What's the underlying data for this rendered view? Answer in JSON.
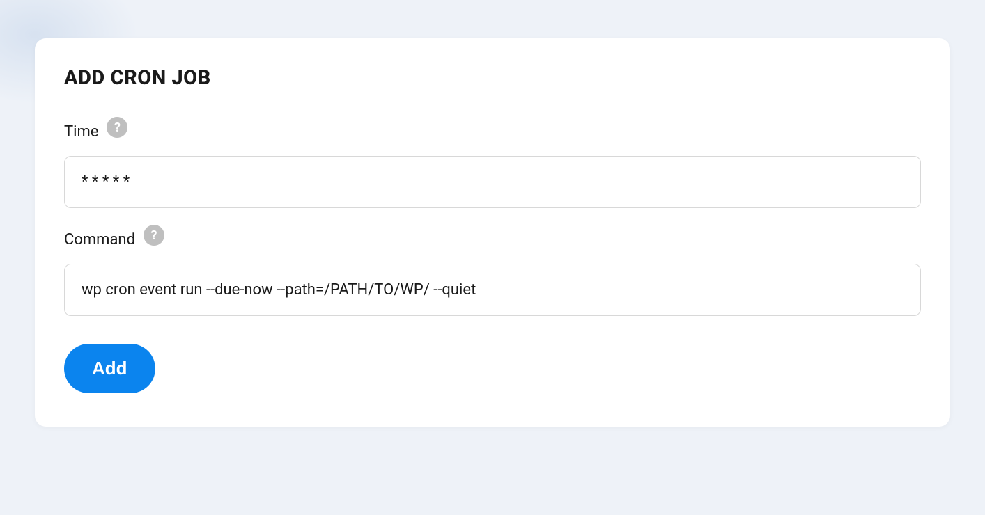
{
  "page": {
    "title": "ADD CRON JOB"
  },
  "form": {
    "time": {
      "label": "Time",
      "value": "* * * * *",
      "help_icon": "?"
    },
    "command": {
      "label": "Command",
      "value": "wp cron event run --due-now --path=/PATH/TO/WP/ --quiet",
      "help_icon": "?"
    },
    "submit_label": "Add"
  }
}
